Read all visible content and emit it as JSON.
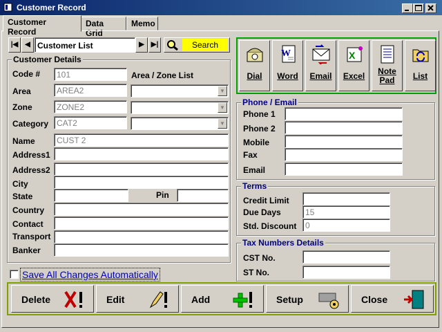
{
  "window": {
    "title": "Customer Record"
  },
  "tabs": [
    {
      "label": "Customer Record"
    },
    {
      "label": "Data Grid"
    },
    {
      "label": "Memo"
    }
  ],
  "nav": {
    "list_value": "Customer List",
    "search_label": "Search",
    "first_glyph": "|◀",
    "prev_glyph": "◀",
    "next_glyph": "▶",
    "last_glyph": "▶|"
  },
  "customer_details": {
    "legend": "Customer Details",
    "code_label": "Code #",
    "code_value": "101",
    "area_zone_list_label": "Area / Zone List",
    "area_label": "Area",
    "area_value": "AREA2",
    "zone_label": "Zone",
    "zone_value": "ZONE2",
    "category_label": "Category",
    "category_value": "CAT2",
    "name_label": "Name",
    "name_value": "CUST 2",
    "address1_label": "Address1",
    "address2_label": "Address2",
    "city_label": "City",
    "state_label": "State",
    "pin_label": "Pin",
    "country_label": "Country",
    "contact_label": "Contact",
    "transport_label": "Transport",
    "banker_label": "Banker"
  },
  "save_auto_label": "Save All Changes Automatically",
  "toolbar": {
    "dial": "Dial",
    "word": "Word",
    "email": "Email",
    "excel": "Excel",
    "notepad_line1": "Note",
    "notepad_line2": "Pad",
    "list": "List"
  },
  "phone_email": {
    "legend": "Phone / Email",
    "phone1_label": "Phone 1",
    "phone2_label": "Phone 2",
    "mobile_label": "Mobile",
    "fax_label": "Fax",
    "email_label": "Email"
  },
  "terms": {
    "legend": "Terms",
    "credit_limit_label": "Credit Limit",
    "due_days_label": "Due Days",
    "due_days_value": "15",
    "std_discount_label": "Std. Discount",
    "std_discount_value": "0"
  },
  "tax": {
    "legend": "Tax Numbers Details",
    "cst_label": "CST No.",
    "st_label": "ST No."
  },
  "actions": {
    "delete": "Delete",
    "edit": "Edit",
    "add": "Add",
    "setup": "Setup",
    "close": "Close"
  },
  "colors": {
    "title_start": "#0a246a",
    "title_end": "#3a6ea5",
    "search_bg": "#ffff00",
    "toolbar_border": "#00a000",
    "bottom_border": "#80a000",
    "group_label_blue": "#000080"
  }
}
